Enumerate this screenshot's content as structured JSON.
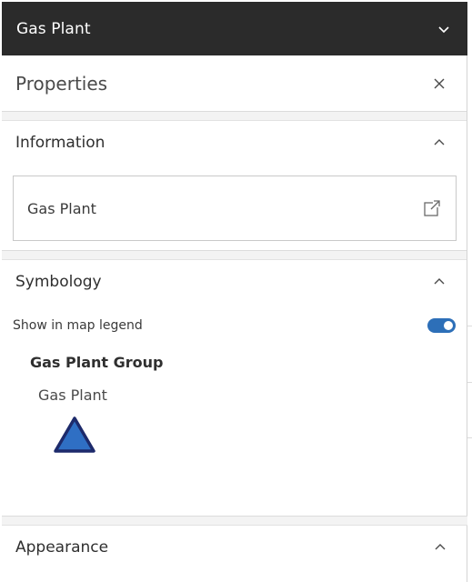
{
  "topbar": {
    "title": "Gas Plant",
    "chevron_icon": "chevron-down-icon"
  },
  "panel": {
    "title": "Properties",
    "close_icon": "close-icon"
  },
  "sections": {
    "information": {
      "title": "Information",
      "collapse_icon": "chevron-up-icon",
      "card_text": "Gas Plant",
      "open_icon": "external-link-icon"
    },
    "symbology": {
      "title": "Symbology",
      "collapse_icon": "chevron-up-icon",
      "legend_label": "Show in map legend",
      "legend_enabled": true,
      "group_title": "Gas Plant Group",
      "item_label": "Gas Plant",
      "symbol_icon": "triangle-symbol-icon"
    },
    "appearance": {
      "title": "Appearance",
      "collapse_icon": "chevron-up-icon"
    }
  },
  "colors": {
    "topbar_bg": "#2b2b2b",
    "toggle_on": "#2d6fb8",
    "symbol_fill": "#2f6fc4",
    "symbol_stroke": "#1d2a6b"
  }
}
